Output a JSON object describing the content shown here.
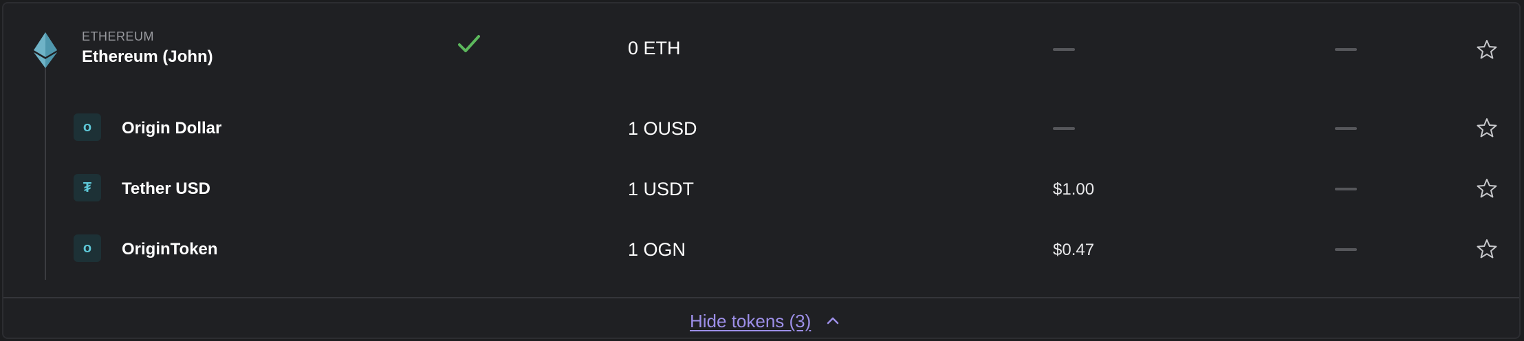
{
  "account": {
    "network_label": "ETHEREUM",
    "name": "Ethereum (John)",
    "balance": "0 ETH",
    "icon": "ethereum-icon",
    "status_icon": "checkmark-icon",
    "status_color": "#5cb85c"
  },
  "tokens": [
    {
      "name": "Origin Dollar",
      "icon_glyph": "o",
      "icon": "origin-dollar-icon",
      "balance": "1 OUSD",
      "price": null
    },
    {
      "name": "Tether USD",
      "icon_glyph": "₮",
      "icon": "tether-icon",
      "balance": "1 USDT",
      "price": "$1.00"
    },
    {
      "name": "OriginToken",
      "icon_glyph": "o",
      "icon": "origin-token-icon",
      "balance": "1 OGN",
      "price": "$0.47"
    }
  ],
  "footer": {
    "hide_tokens_label": "Hide tokens (3)",
    "chevron_icon": "chevron-up-icon",
    "link_color": "#9d8fe8"
  },
  "colors": {
    "background": "#1f2023",
    "token_icon_accent": "#5ec8d8",
    "placeholder_dash": "#56575b"
  }
}
